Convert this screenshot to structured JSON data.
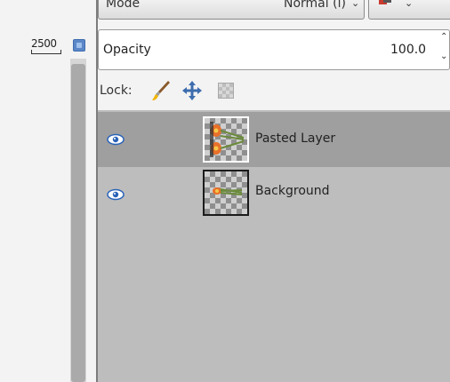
{
  "ruler": {
    "value": "2500"
  },
  "mode": {
    "label": "Mode",
    "value": "Normal (l)",
    "chevron": "⌄"
  },
  "composite": {
    "icon": "composite-mode-icon",
    "chevron": "⌄"
  },
  "opacity": {
    "label": "Opacity",
    "value": "100.0",
    "spin_up": "⌃",
    "spin_down": "⌄"
  },
  "lock": {
    "label": "Lock:",
    "icons": [
      "paintbrush-icon",
      "move-arrows-icon",
      "alpha-checker-icon"
    ]
  },
  "layers": [
    {
      "name": "Pasted Layer",
      "visible": true,
      "selected": true,
      "eye_icon": "eye-icon"
    },
    {
      "name": "Background",
      "visible": true,
      "selected": false,
      "eye_icon": "eye-icon"
    }
  ],
  "colors": {
    "panel": "#bdbdbd",
    "selected_row": "#9f9f9f",
    "eye_blue": "#2a63b8",
    "nav_blue": "#5b87c8"
  }
}
